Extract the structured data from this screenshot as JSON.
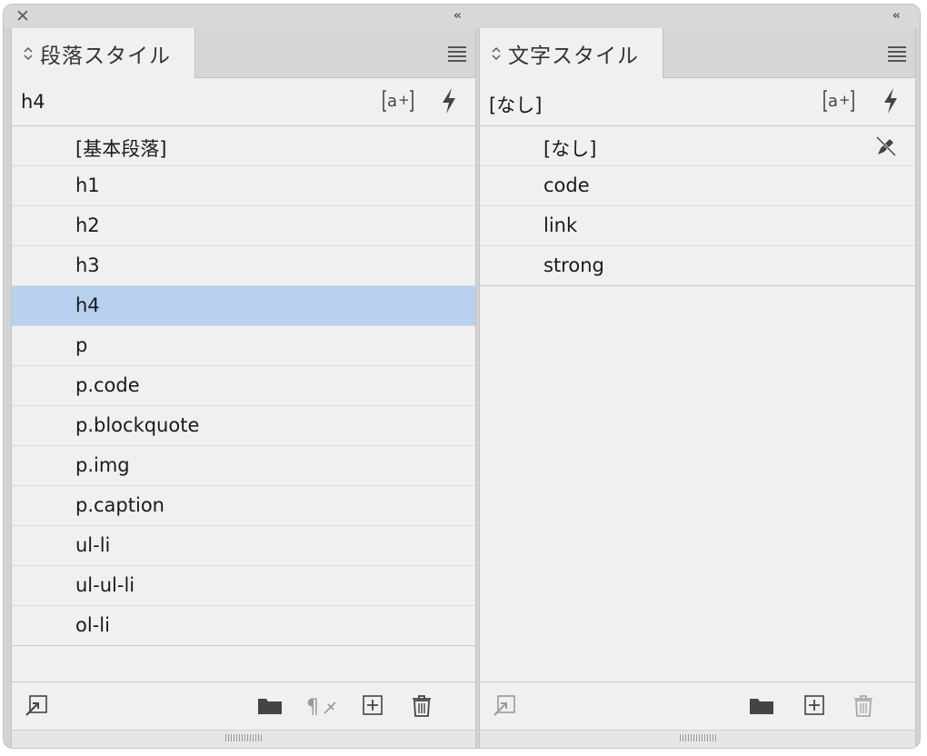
{
  "window": {
    "close_symbol": "✕",
    "collapse_symbol": "‹‹"
  },
  "paragraph_panel": {
    "tab_title": "段落スタイル",
    "current_style": "h4",
    "styles": [
      {
        "label": "[基本段落]",
        "selected": false
      },
      {
        "label": "h1",
        "selected": false
      },
      {
        "label": "h2",
        "selected": false
      },
      {
        "label": "h3",
        "selected": false
      },
      {
        "label": "h4",
        "selected": true
      },
      {
        "label": "p",
        "selected": false
      },
      {
        "label": "p.code",
        "selected": false
      },
      {
        "label": "p.blockquote",
        "selected": false
      },
      {
        "label": "p.img",
        "selected": false
      },
      {
        "label": "p.caption",
        "selected": false
      },
      {
        "label": "ul-li",
        "selected": false
      },
      {
        "label": "ul-ul-li",
        "selected": false
      },
      {
        "label": "ol-li",
        "selected": false
      }
    ]
  },
  "character_panel": {
    "tab_title": "文字スタイル",
    "current_style": "[なし]",
    "styles": [
      {
        "label": "[なし]",
        "selected": false
      },
      {
        "label": "code",
        "selected": false
      },
      {
        "label": "link",
        "selected": false
      },
      {
        "label": "strong",
        "selected": false
      }
    ]
  },
  "icons": {
    "new_style_from_selection": "new-style-icon",
    "quick_apply": "lightning-icon",
    "load_styles": "import-icon",
    "new_group": "folder-icon",
    "clear_overrides": "pilcrow-clear-icon",
    "create_new": "plus-box-icon",
    "delete": "trash-icon",
    "locked": "no-edit-pencil-icon"
  },
  "colors": {
    "selected_row": "#b7d1ee",
    "panel_bg": "#f0f0f0"
  }
}
